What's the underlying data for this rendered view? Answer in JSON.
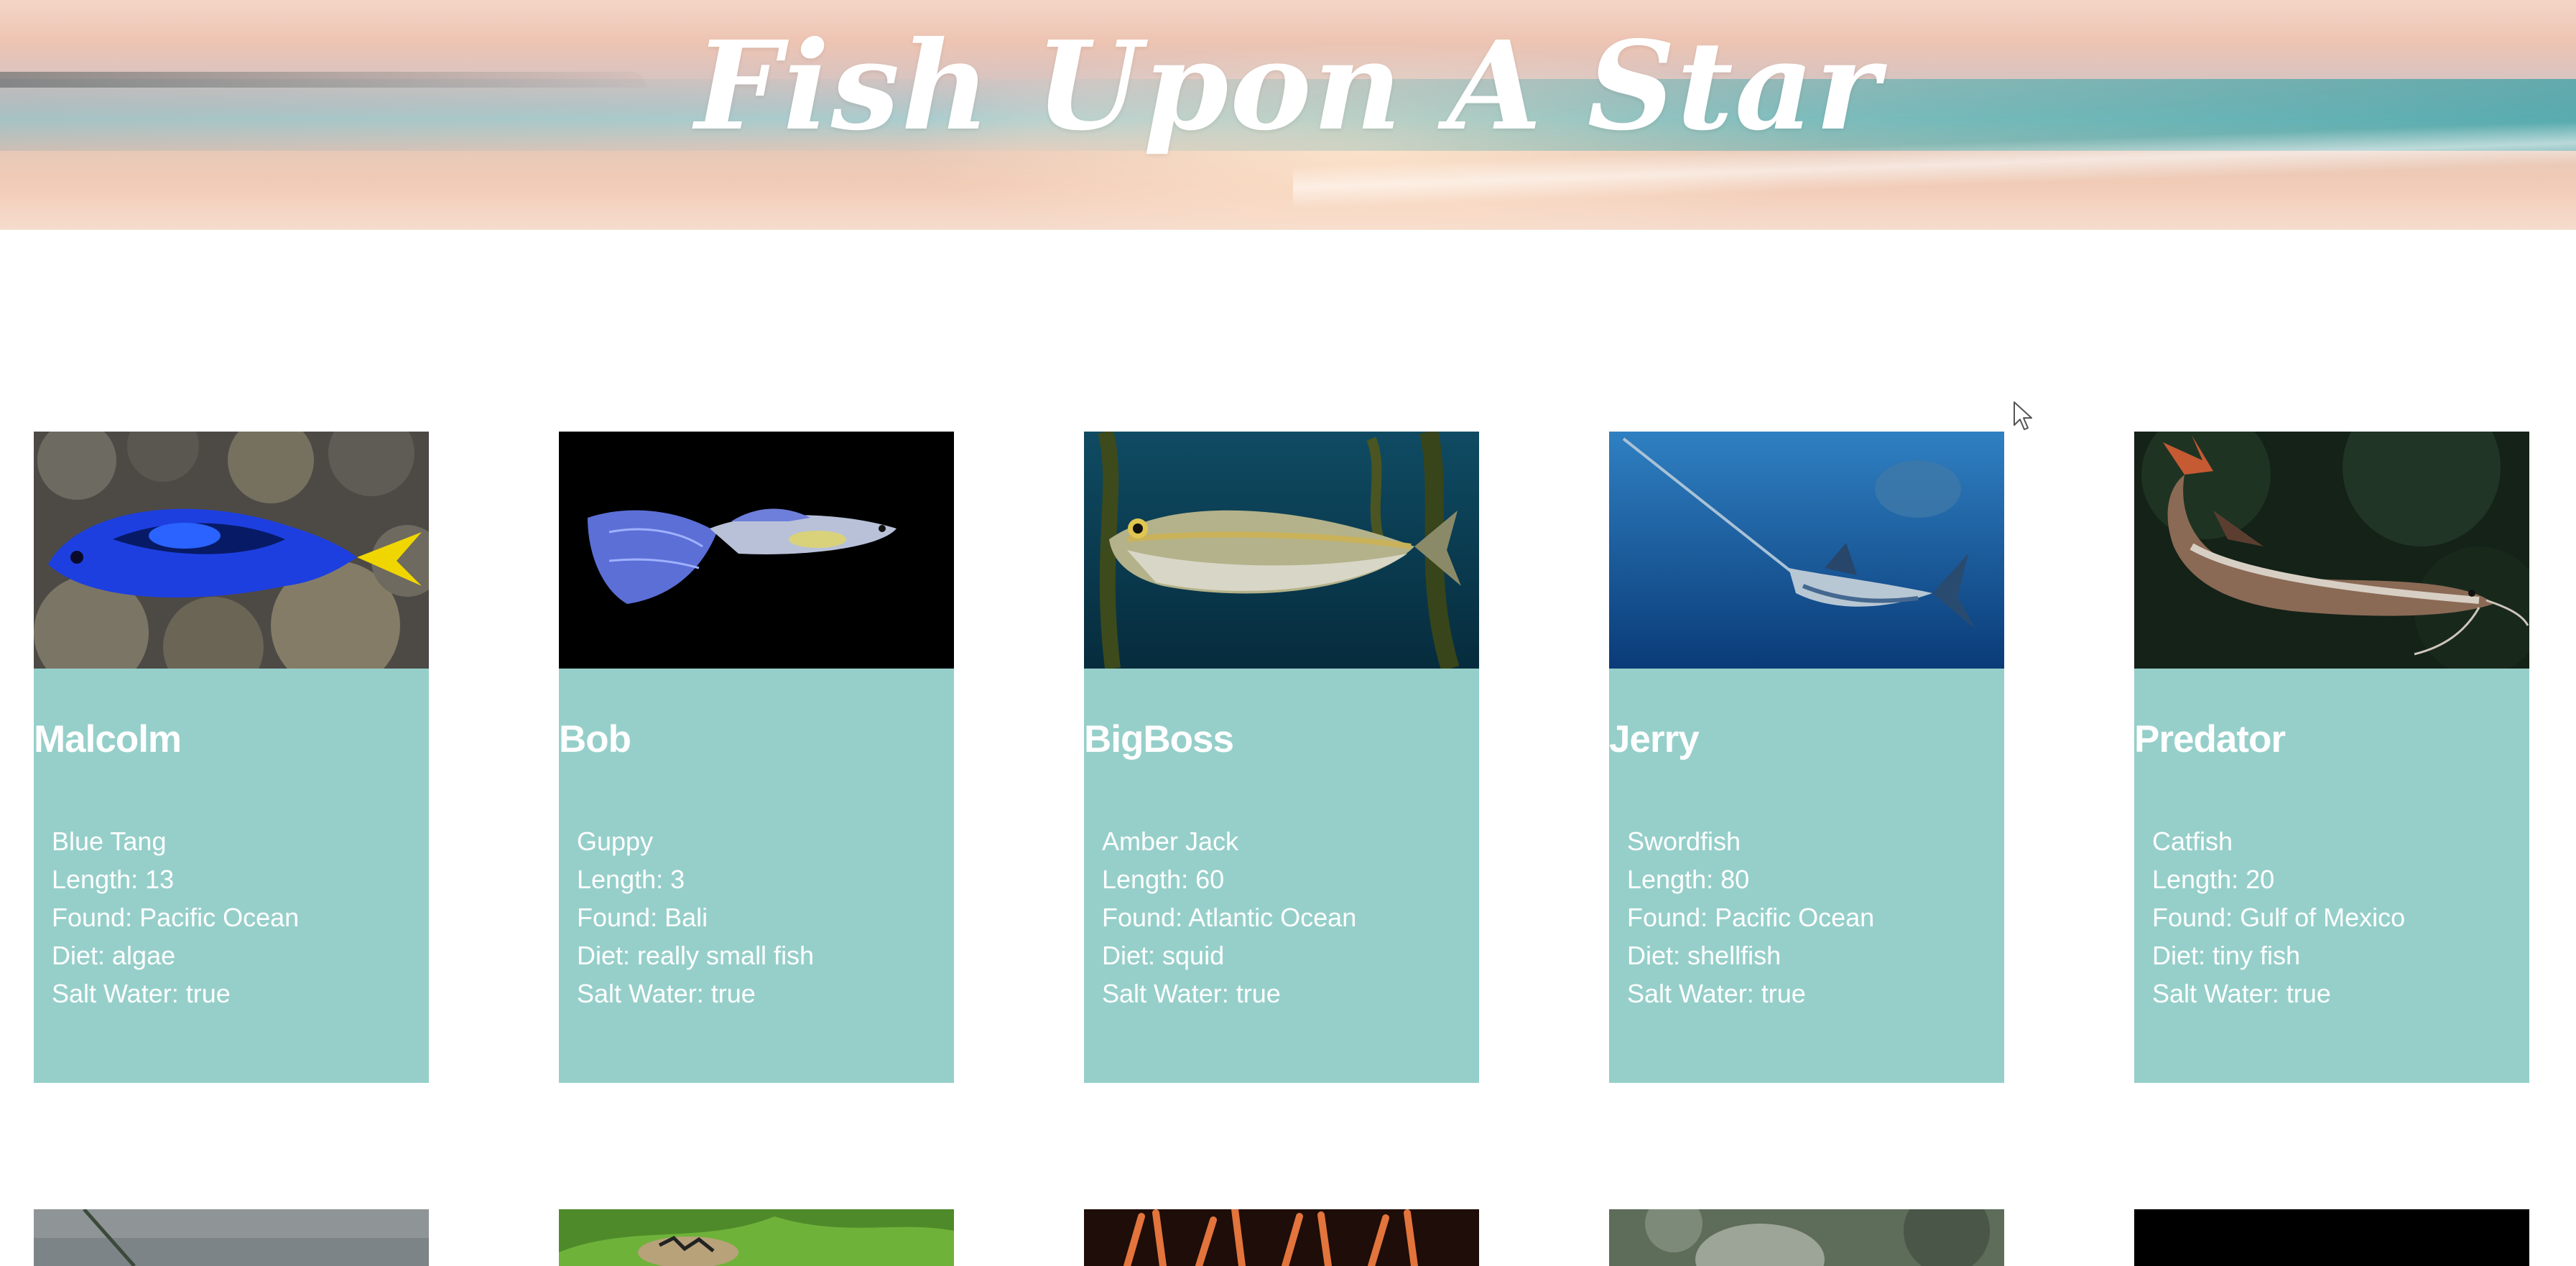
{
  "header": {
    "title": "Fish Upon A Star"
  },
  "fish": [
    {
      "name": "Malcolm",
      "species": "Blue Tang",
      "length": "Length: 13",
      "found": "Found: Pacific Ocean",
      "diet": "Diet: algae",
      "salt_water": "Salt Water: true",
      "photo_icon": "blue-tang-photo"
    },
    {
      "name": "Bob",
      "species": "Guppy",
      "length": "Length: 3",
      "found": "Found: Bali",
      "diet": "Diet: really small fish",
      "salt_water": "Salt Water: true",
      "photo_icon": "guppy-photo"
    },
    {
      "name": "BigBoss",
      "species": "Amber Jack",
      "length": "Length: 60",
      "found": "Found: Atlantic Ocean",
      "diet": "Diet: squid",
      "salt_water": "Salt Water: true",
      "photo_icon": "amber-jack-photo"
    },
    {
      "name": "Jerry",
      "species": "Swordfish",
      "length": "Length: 80",
      "found": "Found: Pacific Ocean",
      "diet": "Diet: shellfish",
      "salt_water": "Salt Water: true",
      "photo_icon": "swordfish-photo"
    },
    {
      "name": "Predator",
      "species": "Catfish",
      "length": "Length: 20",
      "found": "Found: Gulf of Mexico",
      "diet": "Diet: tiny fish",
      "salt_water": "Salt Water: true",
      "photo_icon": "catfish-photo"
    }
  ],
  "colors": {
    "card_background": "#96cfca",
    "card_text": "#ffffff",
    "page_background": "#ffffff"
  }
}
